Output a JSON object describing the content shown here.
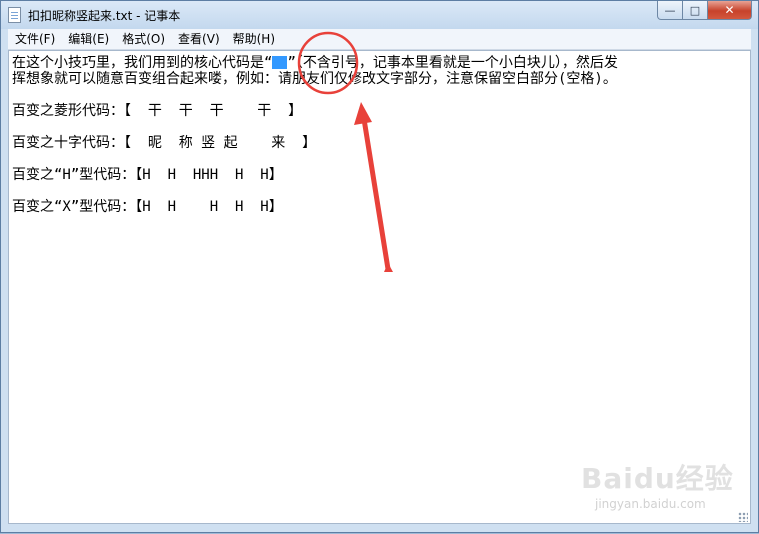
{
  "window": {
    "title": "扣扣昵称竖起来.txt - 记事本",
    "controls": {
      "minimize": "—",
      "maximize": "□",
      "close": "✕"
    }
  },
  "menu": {
    "items": [
      {
        "label": "文件(F)"
      },
      {
        "label": "编辑(E)"
      },
      {
        "label": "格式(O)"
      },
      {
        "label": "查看(V)"
      },
      {
        "label": "帮助(H)"
      }
    ]
  },
  "document": {
    "line1_before": "在这个小技巧里，我们用到的核心代码是“",
    "line1_after": "”（不含引号，记事本里看就是一个小白块儿），然后发",
    "line2": "挥想象就可以随意百变组合起来喽，例如：请朋友们仅修改文字部分，注意保留空白部分(空格)。",
    "line3": "百变之菱形代码：【  干  干  干    干  】",
    "line4": "百变之十字代码：【  昵  称 竖 起    来  】",
    "line5": "百变之“H”型代码：【H  H  HHH  H  H】",
    "line6": "百变之“X”型代码：【H  H    H  H  H】"
  },
  "annotation": {
    "color": "#e8413a"
  },
  "watermark": {
    "logo": "Baidu经验",
    "url": "jingyan.baidu.com"
  }
}
